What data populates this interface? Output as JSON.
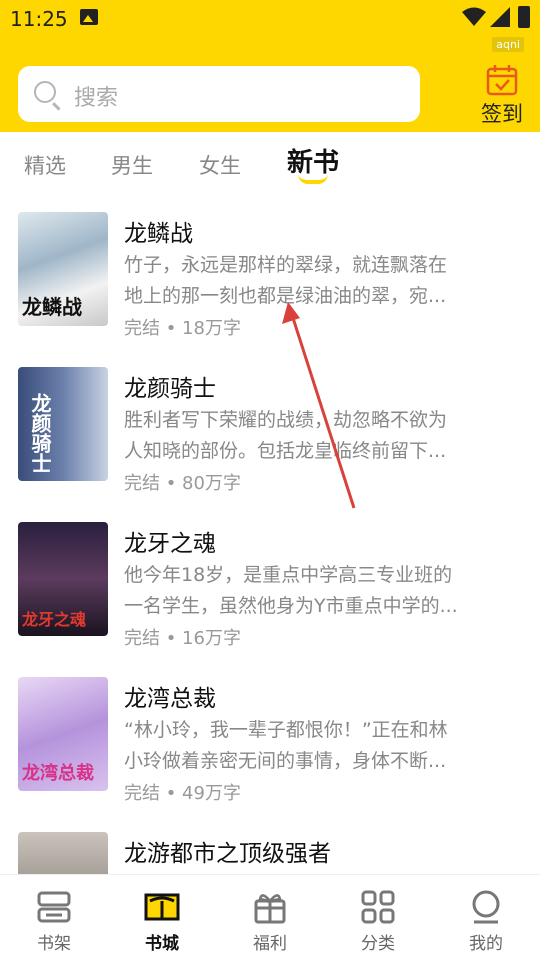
{
  "status_bar": {
    "time": "11:25",
    "badge": "aqni"
  },
  "search": {
    "placeholder": "搜索"
  },
  "signin": {
    "label": "签到"
  },
  "tabs": [
    {
      "label": "精选"
    },
    {
      "label": "男生"
    },
    {
      "label": "女生"
    },
    {
      "label": "新书",
      "active": true
    }
  ],
  "books": [
    {
      "title": "龙鳞战",
      "cover_text": "龙鳞战",
      "desc_line1": "竹子，永远是那样的翠绿，就连飘落在",
      "desc_line2": "地上的那一刻也都是绿油油的翠，宛...",
      "meta": "完结 • 18万字"
    },
    {
      "title": "龙颜骑士",
      "cover_text": "龙颜骑士",
      "desc_line1": "胜利者写下荣耀的战绩，劫忽略不欲为",
      "desc_line2": "人知晓的部份。包括龙皇临终前留下...",
      "meta": "完结 • 80万字"
    },
    {
      "title": "龙牙之魂",
      "cover_text": "龙牙之魂",
      "desc_line1": "他今年18岁，是重点中学高三专业班的",
      "desc_line2": "一名学生，虽然他身为Y市重点中学的...",
      "meta": "完结 • 16万字"
    },
    {
      "title": "龙湾总裁",
      "cover_text": "龙湾总裁",
      "desc_line1": "“林小玲，我一辈子都恨你！”正在和林",
      "desc_line2": "小玲做着亲密无间的事情，身体不断...",
      "meta": "完结 • 49万字"
    },
    {
      "title": "龙游都市之顶级强者",
      "cover_text": "",
      "desc_line1": "",
      "desc_line2": "",
      "meta": ""
    }
  ],
  "bottom_nav": [
    {
      "label": "书架",
      "icon": "bookshelf-icon"
    },
    {
      "label": "书城",
      "icon": "bookstore-icon",
      "active": true
    },
    {
      "label": "福利",
      "icon": "gift-icon"
    },
    {
      "label": "分类",
      "icon": "grid-icon"
    },
    {
      "label": "我的",
      "icon": "profile-icon"
    }
  ],
  "colors": {
    "accent": "#FED701",
    "text": "#111111",
    "muted": "#888888"
  }
}
